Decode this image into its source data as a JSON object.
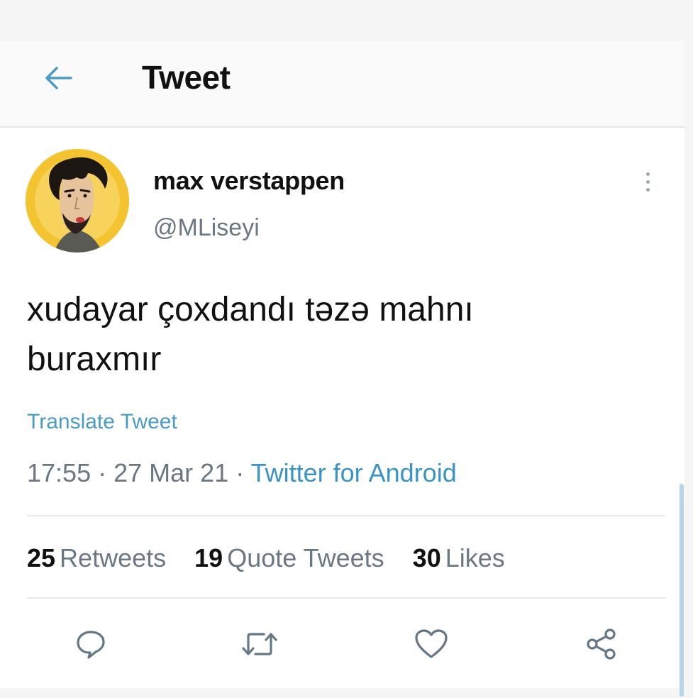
{
  "header": {
    "title": "Tweet",
    "back_icon": "arrow-left-icon",
    "accent_color": "#4a9bc4"
  },
  "tweet": {
    "author": {
      "display_name": "max verstappen",
      "handle": "@MLiseyi",
      "avatar_bg": "#f4c430"
    },
    "text_line1": "xudayar çoxdandı təzə mahnı",
    "text_line2": "buraxmır",
    "translate_label": "Translate Tweet",
    "time": "17:55",
    "separator": "·",
    "date": "27 Mar 21",
    "source": "Twitter for Android",
    "stats": {
      "retweets_count": "25",
      "retweets_label": "Retweets",
      "quotes_count": "19",
      "quotes_label": "Quote Tweets",
      "likes_count": "30",
      "likes_label": "Likes"
    },
    "actions": [
      "reply-icon",
      "retweet-icon",
      "like-icon",
      "share-icon"
    ]
  }
}
